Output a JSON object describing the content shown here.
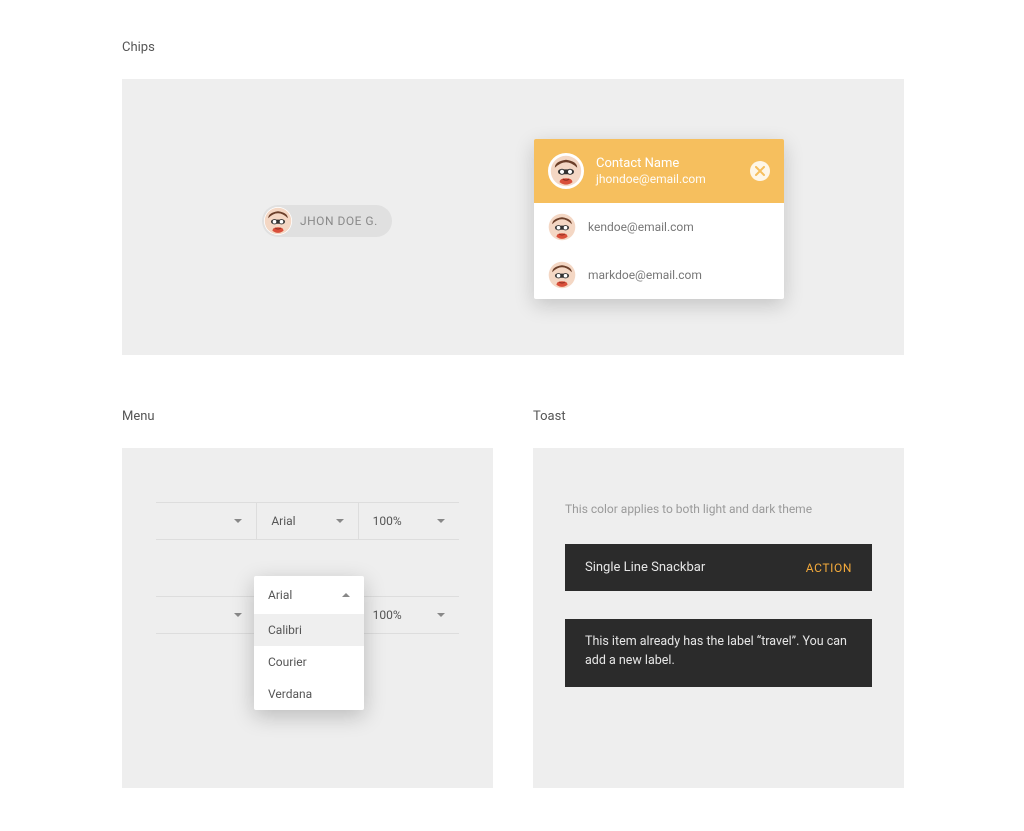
{
  "sections": {
    "chips_title": "Chips",
    "menu_title": "Menu",
    "toast_title": "Toast"
  },
  "chip": {
    "label": "JHON DOE G."
  },
  "contact": {
    "name": "Contact Name",
    "email": "jhondoe@email.com",
    "suggestions": [
      "kendoe@email.com",
      "markdoe@email.com"
    ]
  },
  "menu": {
    "row1": {
      "font": "Arial",
      "zoom": "100%"
    },
    "row2": {
      "font": "Arial",
      "zoom": "100%"
    },
    "dropdown": {
      "current": "Arial",
      "options": [
        "Calibri",
        "Courier",
        "Verdana"
      ],
      "selected_index": 0
    }
  },
  "toast": {
    "hint": "This color applies to both light and dark theme",
    "single_text": "Single Line Snackbar",
    "single_action": "ACTION",
    "multi_text": "This item already has the label “travel”. You can add a new label."
  }
}
